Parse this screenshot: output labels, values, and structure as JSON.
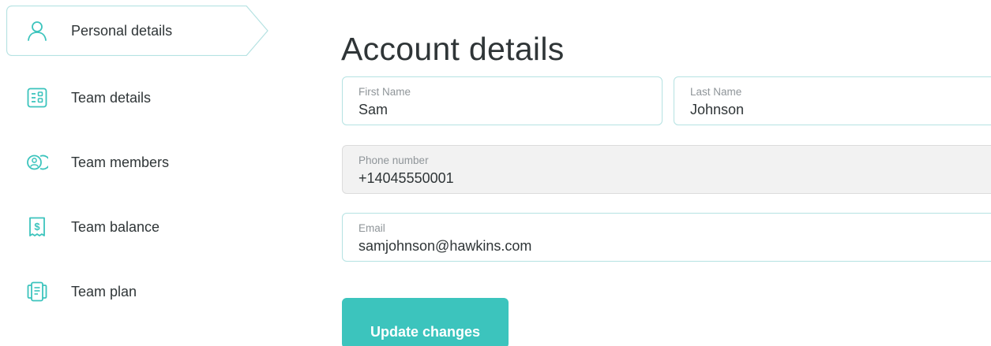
{
  "sidebar": {
    "items": [
      {
        "label": "Personal details",
        "icon": "user-icon",
        "active": true
      },
      {
        "label": "Team details",
        "icon": "team-details-icon",
        "active": false
      },
      {
        "label": "Team members",
        "icon": "team-members-icon",
        "active": false
      },
      {
        "label": "Team balance",
        "icon": "receipt-dollar-icon",
        "active": false
      },
      {
        "label": "Team plan",
        "icon": "plan-card-icon",
        "active": false
      }
    ]
  },
  "main": {
    "title": "Account details",
    "form": {
      "first_name": {
        "label": "First Name",
        "value": "Sam"
      },
      "last_name": {
        "label": "Last Name",
        "value": "Johnson"
      },
      "phone": {
        "label": "Phone number",
        "value": "+14045550001",
        "disabled": true
      },
      "email": {
        "label": "Email",
        "value": "samjohnson@hawkins.com"
      }
    },
    "update_label": "Update changes"
  },
  "colors": {
    "accent": "#3cc4bd",
    "field_border": "#b5e2e2",
    "text": "#2f3537",
    "label": "#8f9599",
    "disabled_bg": "#f2f2f2"
  }
}
